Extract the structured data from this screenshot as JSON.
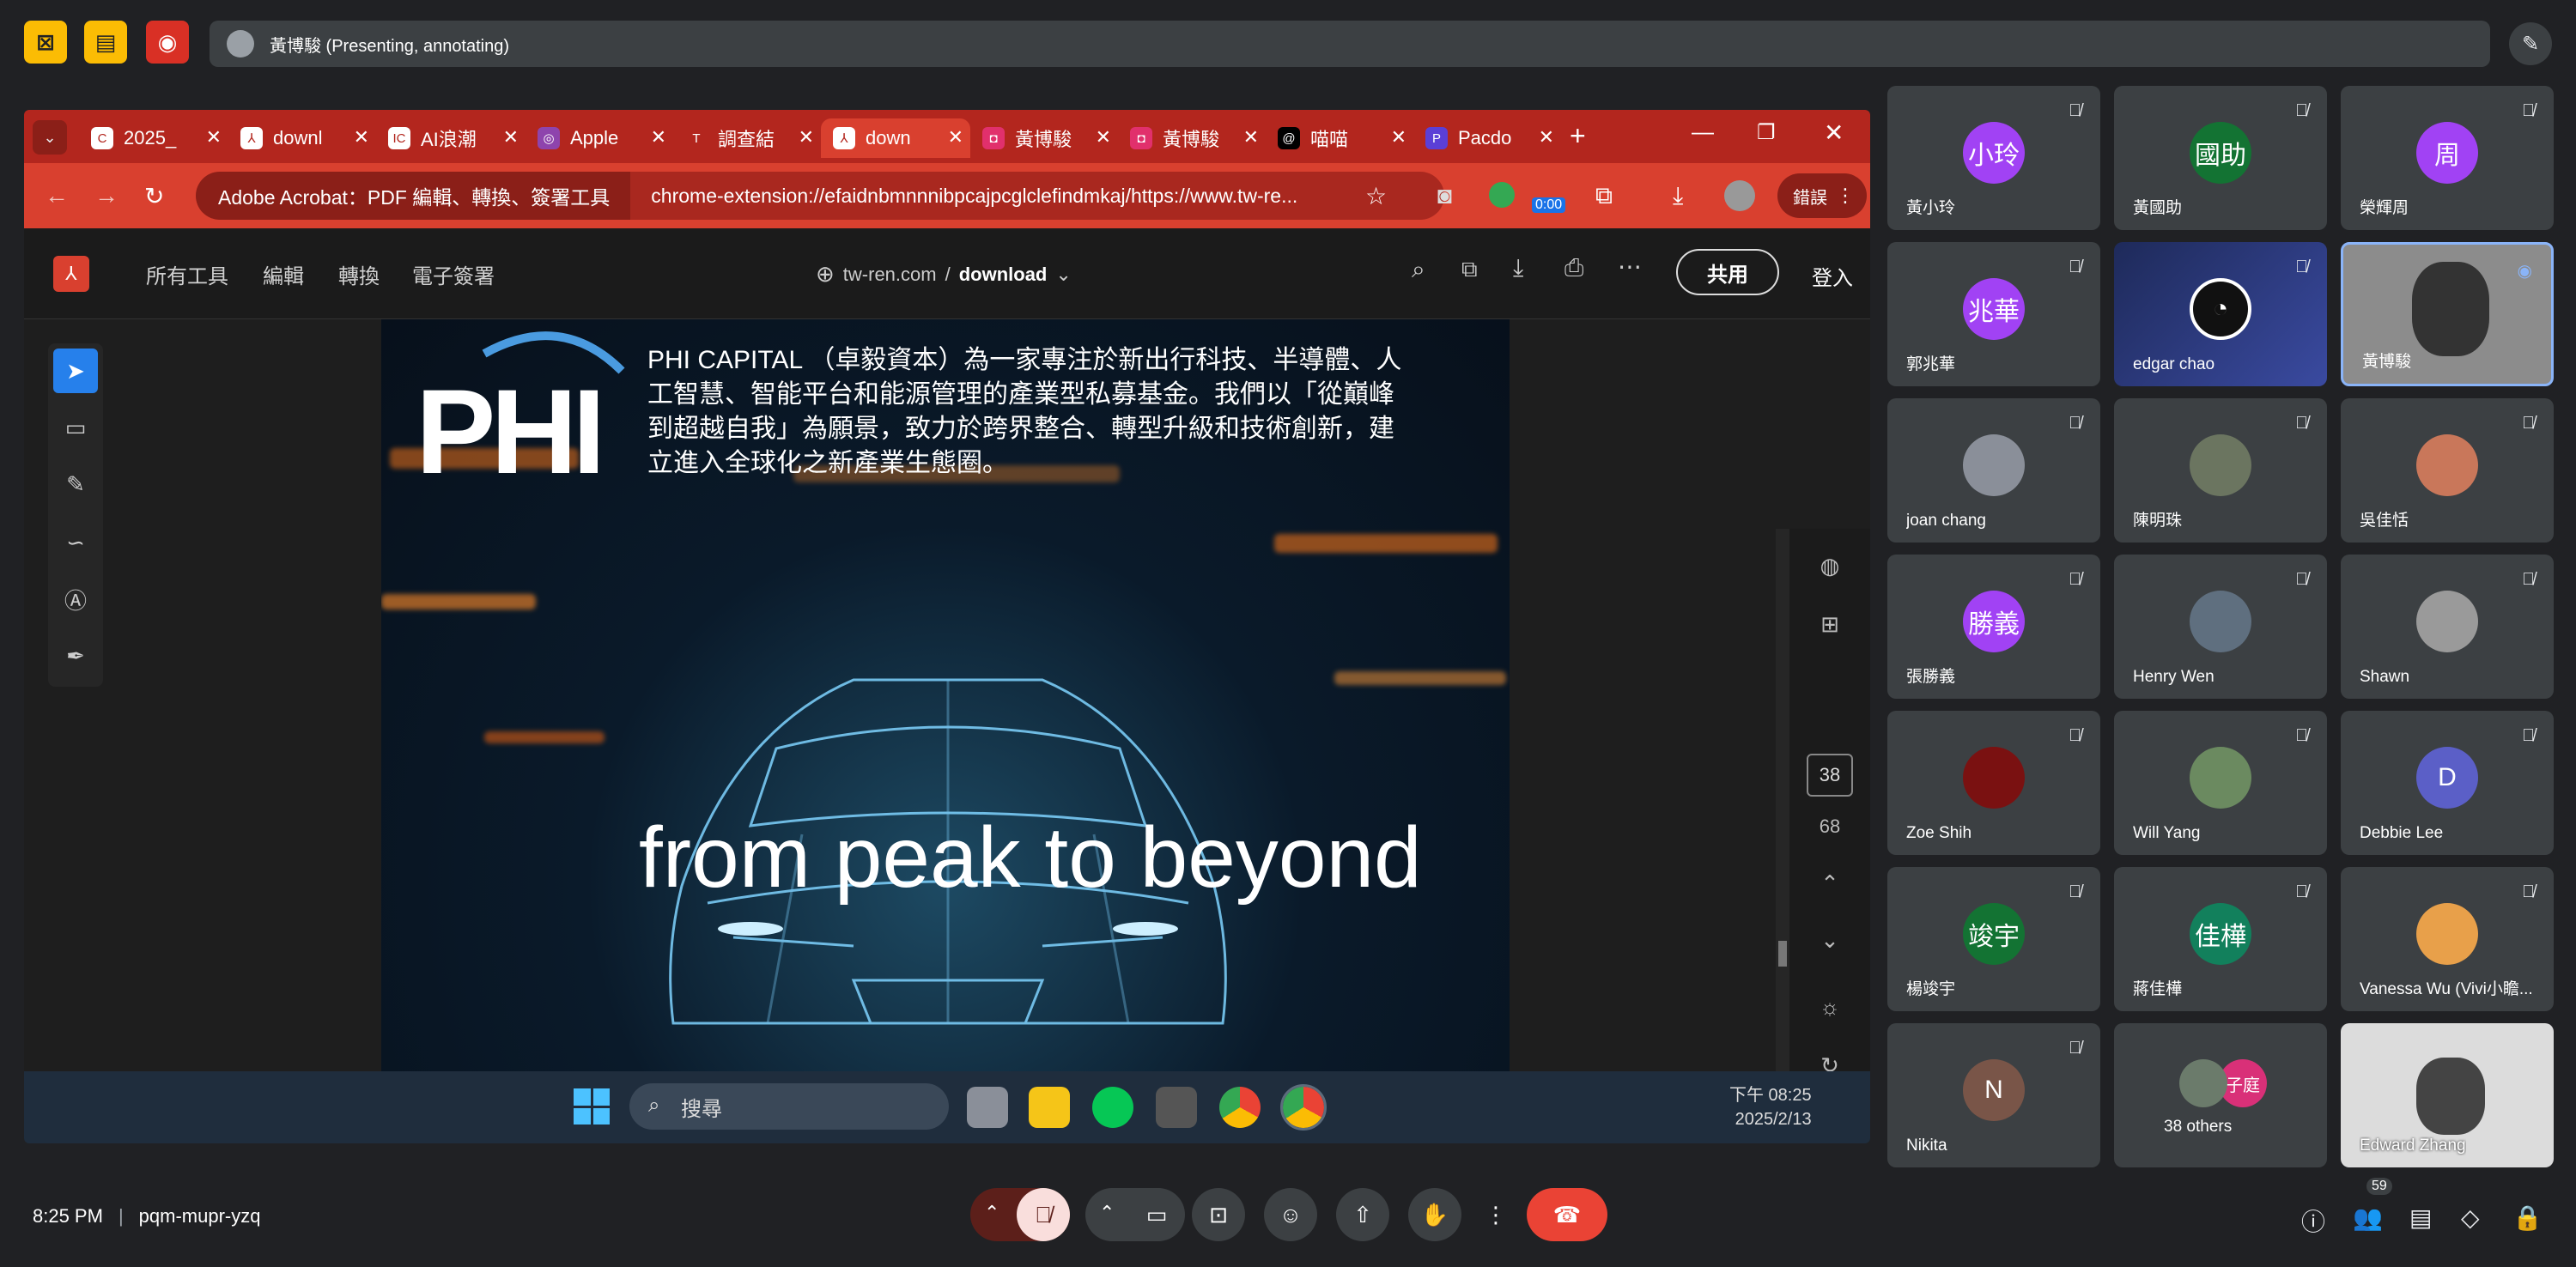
{
  "meet": {
    "presenter_label": "黃博駿 (Presenting, annotating)",
    "time": "8:25 PM",
    "separator": "|",
    "meeting_code": "pqm-mupr-yzq",
    "participants_count": "59"
  },
  "browser": {
    "tabs": [
      {
        "label": "2025_",
        "icon": "C"
      },
      {
        "label": "downl",
        "icon": "pdf"
      },
      {
        "label": "AI浪潮",
        "icon": "AI"
      },
      {
        "label": "Apple",
        "icon": "P"
      },
      {
        "label": "調查結",
        "icon": "T"
      },
      {
        "label": "down",
        "icon": "pdf",
        "active": true
      },
      {
        "label": "黃博駿",
        "icon": "ig"
      },
      {
        "label": "黃博駿",
        "icon": "ig"
      },
      {
        "label": "喵喵",
        "icon": "t"
      },
      {
        "label": "Pacdo",
        "icon": "P"
      }
    ],
    "site_chip": "Adobe Acrobat：PDF 編輯、轉換、簽署工具",
    "url": "chrome-extension://efaidnbmnnnibpcajpcglclefindmkaj/https://www.tw-re...",
    "error_label": "錯誤",
    "timer_badge": "0:00"
  },
  "acrobat": {
    "menu": [
      "所有工具",
      "編輯",
      "轉換",
      "電子簽署"
    ],
    "domain": "tw-ren.com",
    "slash": "/",
    "filename": "download",
    "share": "共用",
    "login": "登入",
    "page_current": "38",
    "page_total": "68"
  },
  "slide": {
    "logo": "PHI",
    "description": "PHI CAPITAL （卓毅資本）為一家專注於新出行科技、半導體、人工智慧、智能平台和能源管理的產業型私募基金。我們以「從巔峰到超越自我」為願景，致力於跨界整合、轉型升級和技術創新，建立進入全球化之新產業生態圈。",
    "tagline": "from peak to beyond"
  },
  "taskbar": {
    "search": "搜尋",
    "time": "下午 08:25",
    "date": "2025/2/13"
  },
  "participants": [
    {
      "name": "黃小玲",
      "initials": "小玲",
      "color": "#a142f4"
    },
    {
      "name": "黃國助",
      "initials": "國助",
      "color": "#137333"
    },
    {
      "name": "榮輝周",
      "initials": "周",
      "color": "#a142f4"
    },
    {
      "name": "郭兆華",
      "initials": "兆華",
      "color": "#a142f4"
    },
    {
      "name": "edgar chao",
      "initials": "",
      "color": "#1e2a5a"
    },
    {
      "name": "黃博駿",
      "initials": "",
      "color": "#8c8c8c"
    },
    {
      "name": "joan chang",
      "initials": "",
      "color": "#8a8f99"
    },
    {
      "name": "陳明珠",
      "initials": "",
      "color": "#6b7560"
    },
    {
      "name": "吳佳恬",
      "initials": "",
      "color": "#c9775a"
    },
    {
      "name": "張勝義",
      "initials": "勝義",
      "color": "#a142f4"
    },
    {
      "name": "Henry Wen",
      "initials": "",
      "color": "#5f6f7f"
    },
    {
      "name": "Shawn",
      "initials": "",
      "color": "#9a9a9a"
    },
    {
      "name": "Zoe Shih",
      "initials": "",
      "color": "#7a1111"
    },
    {
      "name": "Will Yang",
      "initials": "",
      "color": "#6b8a60"
    },
    {
      "name": "Debbie Lee",
      "initials": "D",
      "color": "#5b5fc7"
    },
    {
      "name": "楊竣宇",
      "initials": "竣宇",
      "color": "#137333"
    },
    {
      "name": "蔣佳樺",
      "initials": "佳樺",
      "color": "#12805c"
    },
    {
      "name": "Vanessa Wu (Vivi小瞻...",
      "initials": "",
      "color": "#e8a04a"
    },
    {
      "name": "Nikita",
      "initials": "N",
      "color": "#795548"
    },
    {
      "name": "38 others",
      "initials": "子庭",
      "color": "#d93078"
    },
    {
      "name": "Edward Zhang",
      "initials": "",
      "color": "#dcdcdc"
    }
  ],
  "colors": {
    "tab_red": "#b3261e",
    "hangup": "#ea4335",
    "mic_off": "#f9dedc"
  }
}
